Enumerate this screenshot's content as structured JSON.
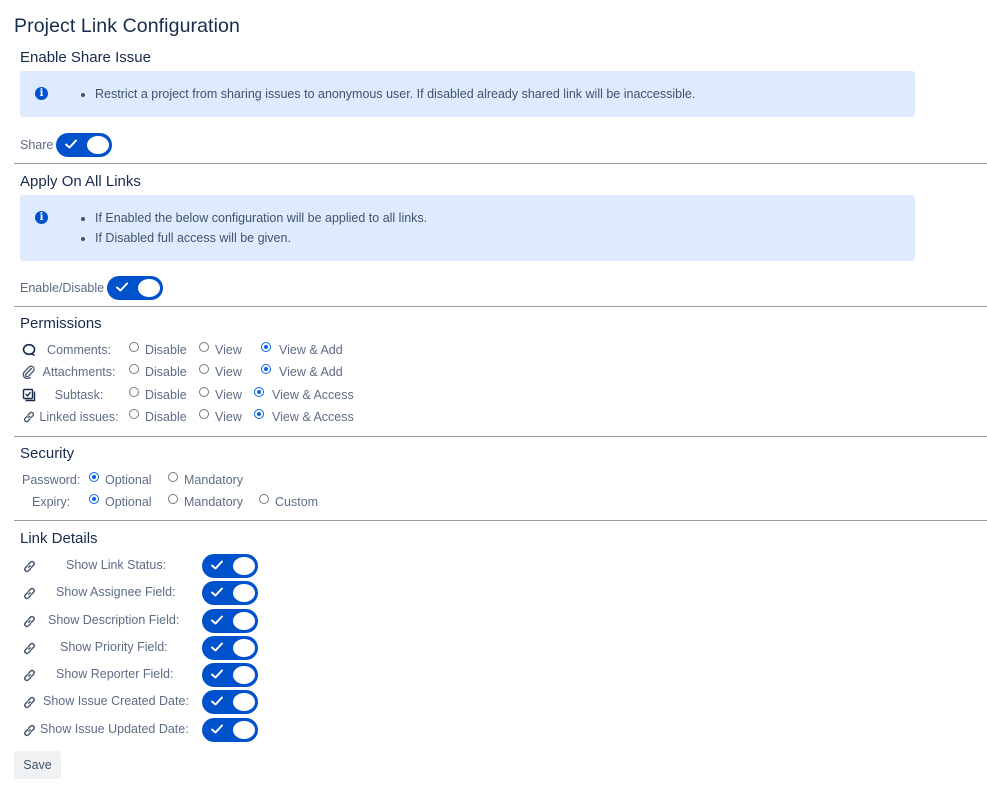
{
  "page": {
    "title": "Project Link Configuration"
  },
  "colors": {
    "accent": "#0052cc",
    "info_bg": "#deebff",
    "radio_checked": "#0a66e8"
  },
  "share_section": {
    "title": "Enable Share Issue",
    "info_items": [
      "Restrict a project from sharing issues to anonymous user. If disabled already shared link will be inaccessible."
    ],
    "toggle": {
      "label": "Share",
      "enabled": true
    }
  },
  "apply_section": {
    "title": "Apply On All Links",
    "info_items": [
      "If Enabled the below configuration will be applied to all links.",
      "If Disabled full access will be given."
    ],
    "toggle": {
      "label": "Enable/Disable",
      "enabled": true
    }
  },
  "permissions": {
    "title": "Permissions",
    "rows": [
      {
        "icon": "comment-icon",
        "label": "Comments:",
        "options": [
          "Disable",
          "View",
          "View & Add"
        ],
        "selected": "View & Add"
      },
      {
        "icon": "attachment-icon",
        "label": "Attachments:",
        "options": [
          "Disable",
          "View",
          "View & Add"
        ],
        "selected": "View & Add"
      },
      {
        "icon": "subtask-icon",
        "label": "Subtask:",
        "options": [
          "Disable",
          "View",
          "View & Access"
        ],
        "selected": "View & Access"
      },
      {
        "icon": "link-icon",
        "label": "Linked issues:",
        "options": [
          "Disable",
          "View",
          "View & Access"
        ],
        "selected": "View & Access"
      }
    ]
  },
  "security": {
    "title": "Security",
    "rows": [
      {
        "label": "Password:",
        "options": [
          "Optional",
          "Mandatory"
        ],
        "selected": "Optional"
      },
      {
        "label": "Expiry:",
        "options": [
          "Optional",
          "Mandatory",
          "Custom"
        ],
        "selected": "Optional"
      }
    ]
  },
  "link_details": {
    "title": "Link Details",
    "rows": [
      {
        "label": "Show Link Status:",
        "enabled": true
      },
      {
        "label": "Show Assignee Field:",
        "enabled": true
      },
      {
        "label": "Show Description Field:",
        "enabled": true
      },
      {
        "label": "Show Priority Field:",
        "enabled": true
      },
      {
        "label": "Show Reporter Field:",
        "enabled": true
      },
      {
        "label": "Show Issue Created Date:",
        "enabled": true
      },
      {
        "label": "Show Issue Updated Date:",
        "enabled": true
      }
    ]
  },
  "actions": {
    "save_label": "Save"
  }
}
